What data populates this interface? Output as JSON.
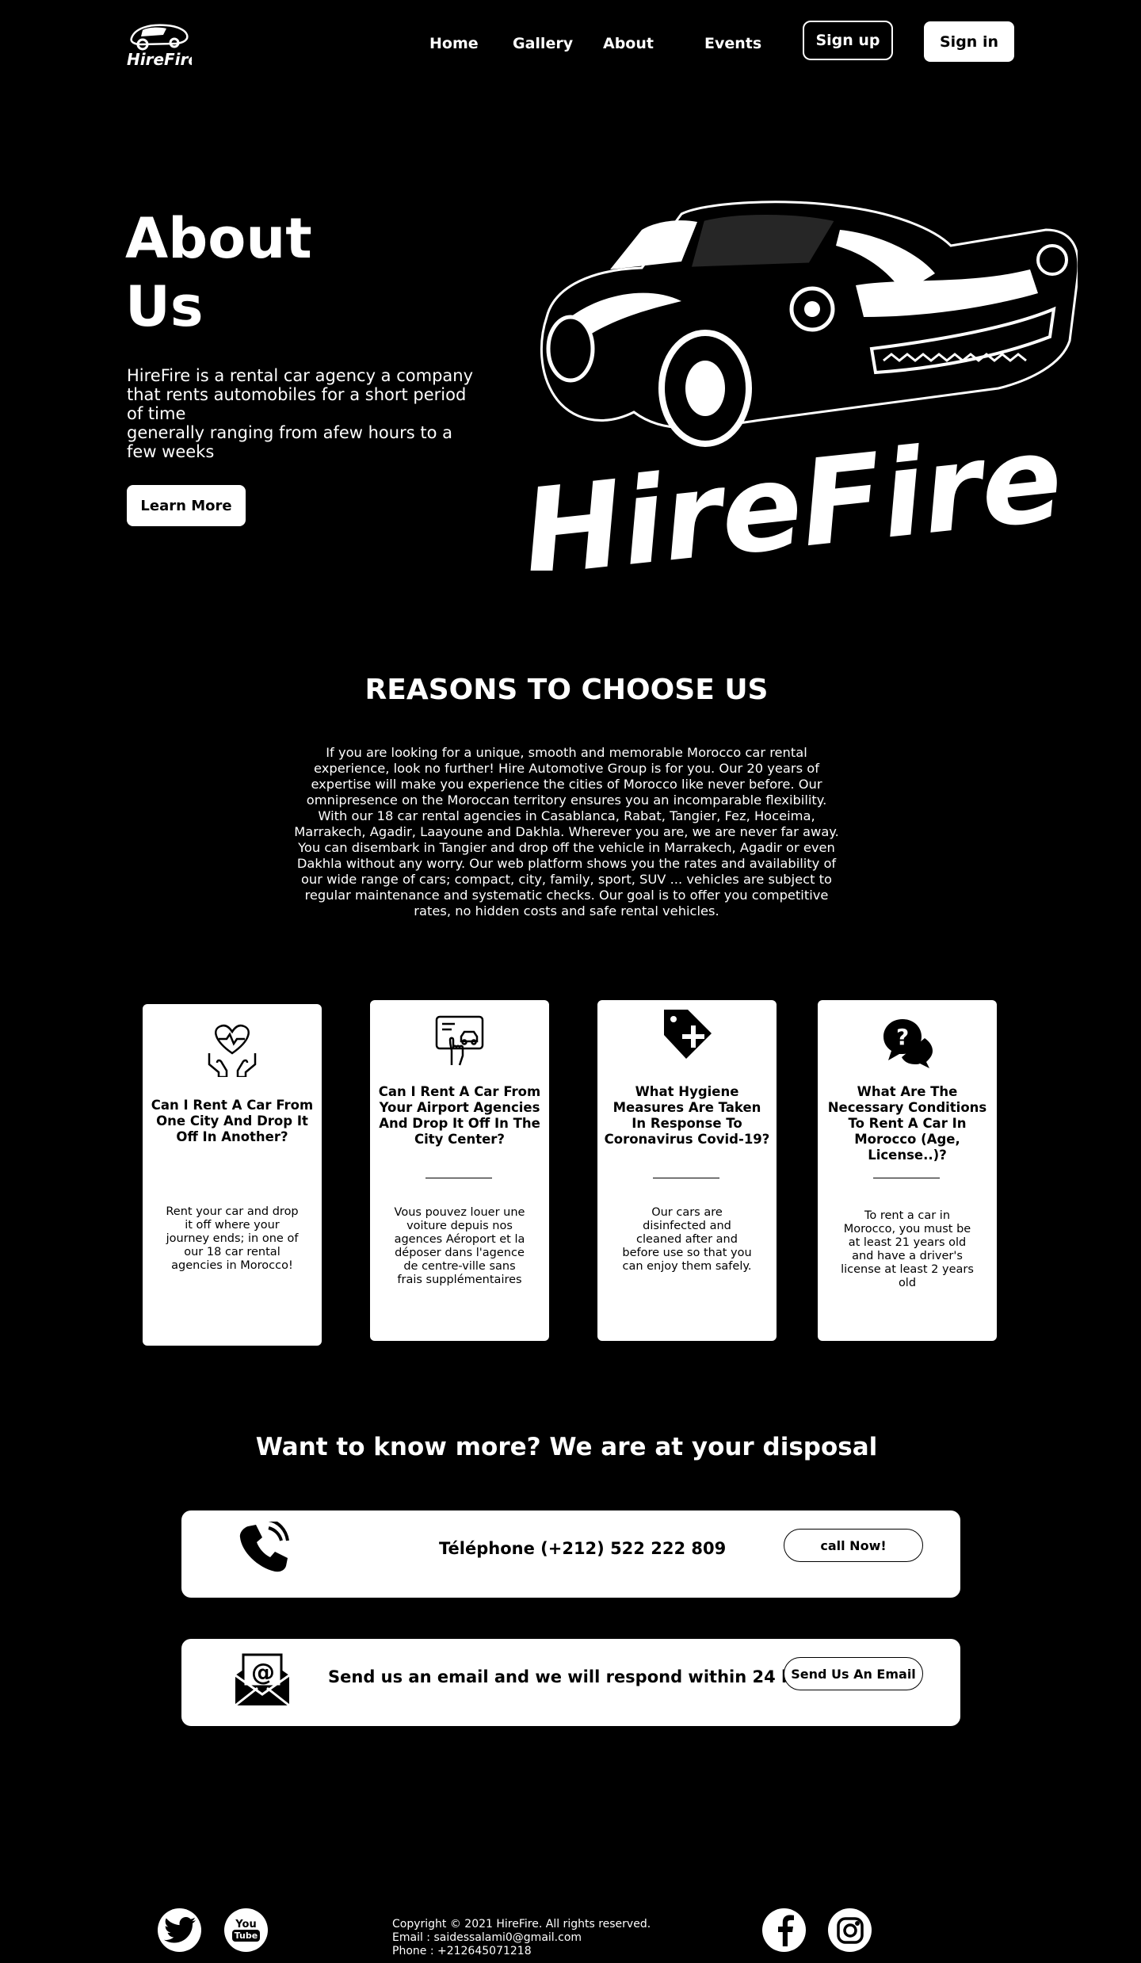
{
  "brand": {
    "name": "HireFire"
  },
  "nav": {
    "links": [
      "Home",
      "Gallery",
      "About",
      "Events"
    ],
    "signup": "Sign up",
    "signin": "Sign in"
  },
  "hero": {
    "title_line1": "About",
    "title_line2": "Us",
    "paragraph1": "HireFire is a rental car agency a company that rents automobiles for a short period of time",
    "paragraph2": "generally ranging from afew hours to a few weeks",
    "cta": "Learn More"
  },
  "reasons": {
    "title": "REASONS TO CHOOSE US",
    "text": "If you are looking for a unique, smooth and memorable Morocco car rental experience, look no further! Hire Automotive Group is for you. Our 20 years of expertise will make you experience the cities of Morocco like never before. Our omnipresence on the Moroccan territory ensures you an incomparable flexibility. With our 18 car rental agencies in Casablanca, Rabat, Tangier, Fez, Hoceima, Marrakech, Agadir, Laayoune and Dakhla. Wherever you are, we are never far away. You can disembark in Tangier and drop off the vehicle in Marrakech, Agadir or even Dakhla without any worry. Our web platform shows you the rates and availability of our wide range of cars; compact, city, family, sport, SUV ... vehicles are subject to regular maintenance and systematic checks. Our goal is to offer you competitive rates, no hidden costs and safe rental vehicles."
  },
  "faq": [
    {
      "icon": "heart-hands-icon",
      "question": "Can I Rent A Car From One City And Drop It Off In Another?",
      "answer": "Rent your car and drop it off where your journey ends; in one of our 18 car rental agencies in Morocco!"
    },
    {
      "icon": "touch-screen-car-icon",
      "question": "Can I Rent A Car From Your Airport Agencies And Drop It Off In The City Center?",
      "answer": "Vous pouvez louer une voiture depuis nos agences Aéroport et la déposer dans l'agence de centre-ville sans frais supplémentaires"
    },
    {
      "icon": "tag-plus-icon",
      "question": "What Hygiene Measures Are Taken In Response To Coronavirus Covid-19?",
      "answer": "Our cars are disinfected and cleaned after and before use so that you can enjoy them safely."
    },
    {
      "icon": "question-chat-icon",
      "question": "What Are The Necessary Conditions To Rent A Car In Morocco (Age, License..)?",
      "answer": "To rent a car in Morocco, you must be at least 21 years old and have a driver's license at least 2 years old"
    }
  ],
  "contact": {
    "title": "Want to know more? We are at your disposal",
    "phone_text": "Téléphone (+212) 522 222 809",
    "phone_btn": "call Now!",
    "email_text": "Send us an email and we will respond within 24 hours",
    "email_btn": "Send Us An Email"
  },
  "footer": {
    "copyright": "Copyright © 2021 HireFire. All rights reserved.",
    "email": "Email : saidessalami0@gmail.com",
    "phone": "Phone : +212645071218",
    "youtube_top": "You",
    "youtube_bottom": "Tube"
  }
}
